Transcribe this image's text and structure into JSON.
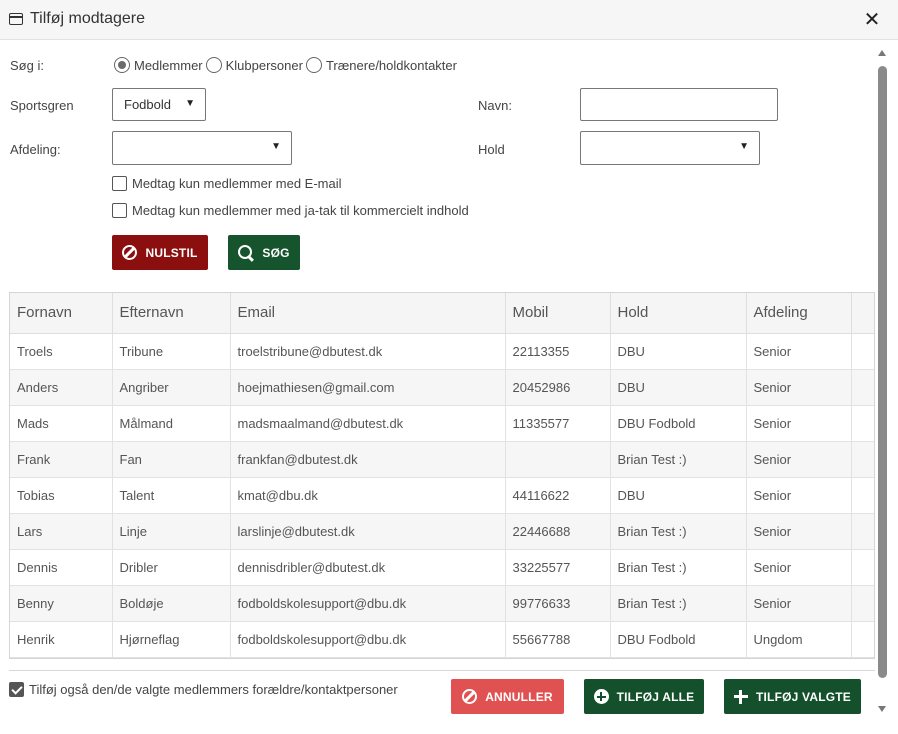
{
  "dialog": {
    "title": "Tilføj modtagere",
    "close_label": "✕"
  },
  "search_in": {
    "label": "Søg i:",
    "options": [
      {
        "label": "Medlemmer",
        "selected": true
      },
      {
        "label": "Klubpersoner",
        "selected": false
      },
      {
        "label": "Trænere/holdkontakter",
        "selected": false
      }
    ]
  },
  "filters": {
    "sport_label": "Sportsgren",
    "sport_value": "Fodbold",
    "name_label": "Navn:",
    "name_value": "",
    "department_label": "Afdeling:",
    "department_value": "",
    "team_label": "Hold",
    "team_value": ""
  },
  "checkboxes": {
    "email_only": {
      "label": "Medtag kun medlemmer med E-mail",
      "checked": false
    },
    "commercial_only": {
      "label": "Medtag kun medlemmer med ja-tak til kommercielt indhold",
      "checked": false
    }
  },
  "buttons": {
    "reset": "NULSTIL",
    "search": "SØG",
    "cancel": "ANNULLER",
    "add_all": "TILFØJ ALLE",
    "add_selected": "TILFØJ VALGTE"
  },
  "table": {
    "columns": [
      "Fornavn",
      "Efternavn",
      "Email",
      "Mobil",
      "Hold",
      "Afdeling",
      ""
    ],
    "rows": [
      [
        "Troels",
        "Tribune",
        "troelstribune@dbutest.dk",
        "22113355",
        "DBU",
        "Senior",
        ""
      ],
      [
        "Anders",
        "Angriber",
        "hoejmathiesen@gmail.com",
        "20452986",
        "DBU",
        "Senior",
        ""
      ],
      [
        "Mads",
        "Målmand",
        "madsmaalmand@dbutest.dk",
        "11335577",
        "DBU Fodbold",
        "Senior",
        ""
      ],
      [
        "Frank",
        "Fan",
        "frankfan@dbutest.dk",
        "",
        "Brian Test :)",
        "Senior",
        ""
      ],
      [
        "Tobias",
        "Talent",
        "kmat@dbu.dk",
        "44116622",
        "DBU",
        "Senior",
        ""
      ],
      [
        "Lars",
        "Linje",
        "larslinje@dbutest.dk",
        "22446688",
        "Brian Test :)",
        "Senior",
        ""
      ],
      [
        "Dennis",
        "Dribler",
        "dennisdribler@dbutest.dk",
        "33225577",
        "Brian Test :)",
        "Senior",
        ""
      ],
      [
        "Benny",
        "Boldøje",
        "fodboldskolesupport@dbu.dk",
        "99776633",
        "Brian Test :)",
        "Senior",
        ""
      ],
      [
        "Henrik",
        "Hjørneflag",
        "fodboldskolesupport@dbu.dk",
        "55667788",
        "DBU Fodbold",
        "Ungdom",
        ""
      ]
    ]
  },
  "footer": {
    "include_parents": {
      "label": "Tilføj også den/de valgte medlemmers forældre/kontaktpersoner",
      "checked": true
    }
  },
  "colors": {
    "reset_button": "#8b0f0f",
    "search_button": "#15542c",
    "cancel_button": "#e05151",
    "add_button": "#13502b"
  },
  "icons": {
    "window": "window-icon",
    "close": "close-icon",
    "reset": "ban-icon",
    "search": "search-icon",
    "cancel": "ban-icon",
    "add_all": "plus-circle-icon",
    "add_selected": "plus-icon"
  }
}
